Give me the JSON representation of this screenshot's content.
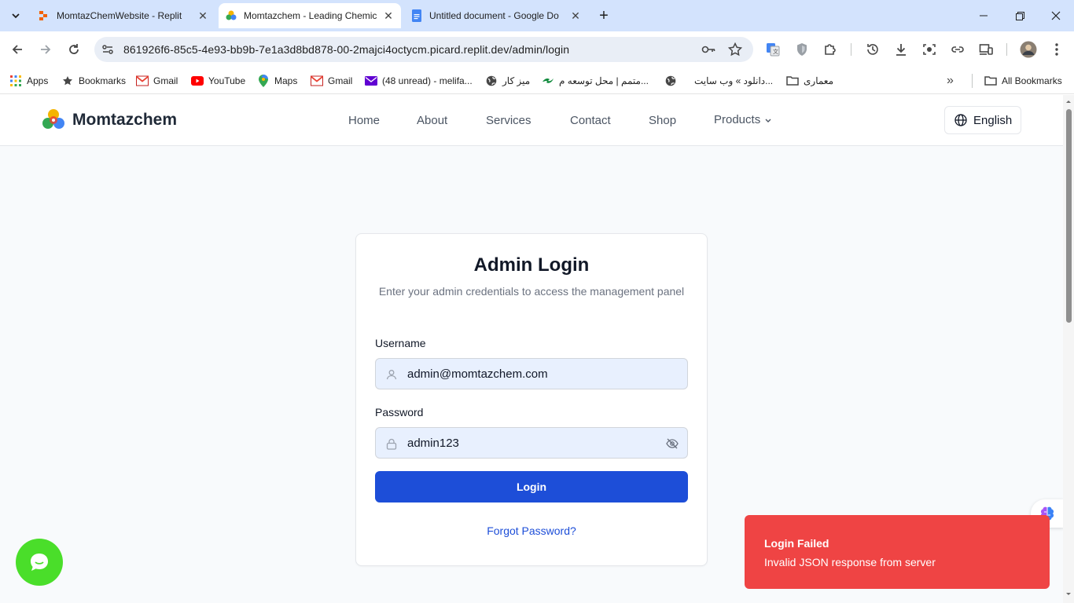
{
  "browser": {
    "tabs": [
      {
        "title": "MomtazChemWebsite - Replit",
        "close": "✕"
      },
      {
        "title": "Momtazchem - Leading Chemic",
        "close": "✕"
      },
      {
        "title": "Untitled document - Google Do",
        "close": "✕"
      }
    ],
    "new_tab": "+",
    "url": "861926f6-85c5-4e93-bb9b-7e1a3d8bd878-00-2majci4octycm.picard.replit.dev/admin/login",
    "bookmarks": [
      {
        "label": "Apps",
        "icon": "apps-grid-icon"
      },
      {
        "label": "Bookmarks",
        "icon": "star-icon"
      },
      {
        "label": "Gmail",
        "icon": "gmail-icon"
      },
      {
        "label": "YouTube",
        "icon": "youtube-icon"
      },
      {
        "label": "Maps",
        "icon": "maps-icon"
      },
      {
        "label": "Gmail",
        "icon": "gmail-icon"
      },
      {
        "label": "(48 unread) - melifa...",
        "icon": "yahoo-mail-icon"
      },
      {
        "label": "میز کار",
        "icon": "globe-icon"
      },
      {
        "label": "متمم | محل توسعه م...",
        "icon": "motamem-icon"
      },
      {
        "label": "دانلود » وب سایت...",
        "icon": "globe-icon"
      },
      {
        "label": "معماری",
        "icon": "folder-icon"
      }
    ],
    "overflow": "»",
    "all_bookmarks": "All Bookmarks"
  },
  "site": {
    "brand": "Momtazchem",
    "nav": [
      "Home",
      "About",
      "Services",
      "Contact",
      "Shop",
      "Products"
    ],
    "language": "English"
  },
  "login": {
    "title": "Admin Login",
    "subtitle": "Enter your admin credentials to access the management panel",
    "username_label": "Username",
    "username_value": "admin@momtazchem.com",
    "password_label": "Password",
    "password_value": "admin123",
    "submit": "Login",
    "forgot": "Forgot Password?"
  },
  "toast": {
    "title": "Login Failed",
    "message": "Invalid JSON response from server"
  },
  "colors": {
    "primary": "#1d4ed8",
    "toast": "#ef4444",
    "chat": "#4ade2a",
    "tabstrip": "#d3e3fd"
  }
}
